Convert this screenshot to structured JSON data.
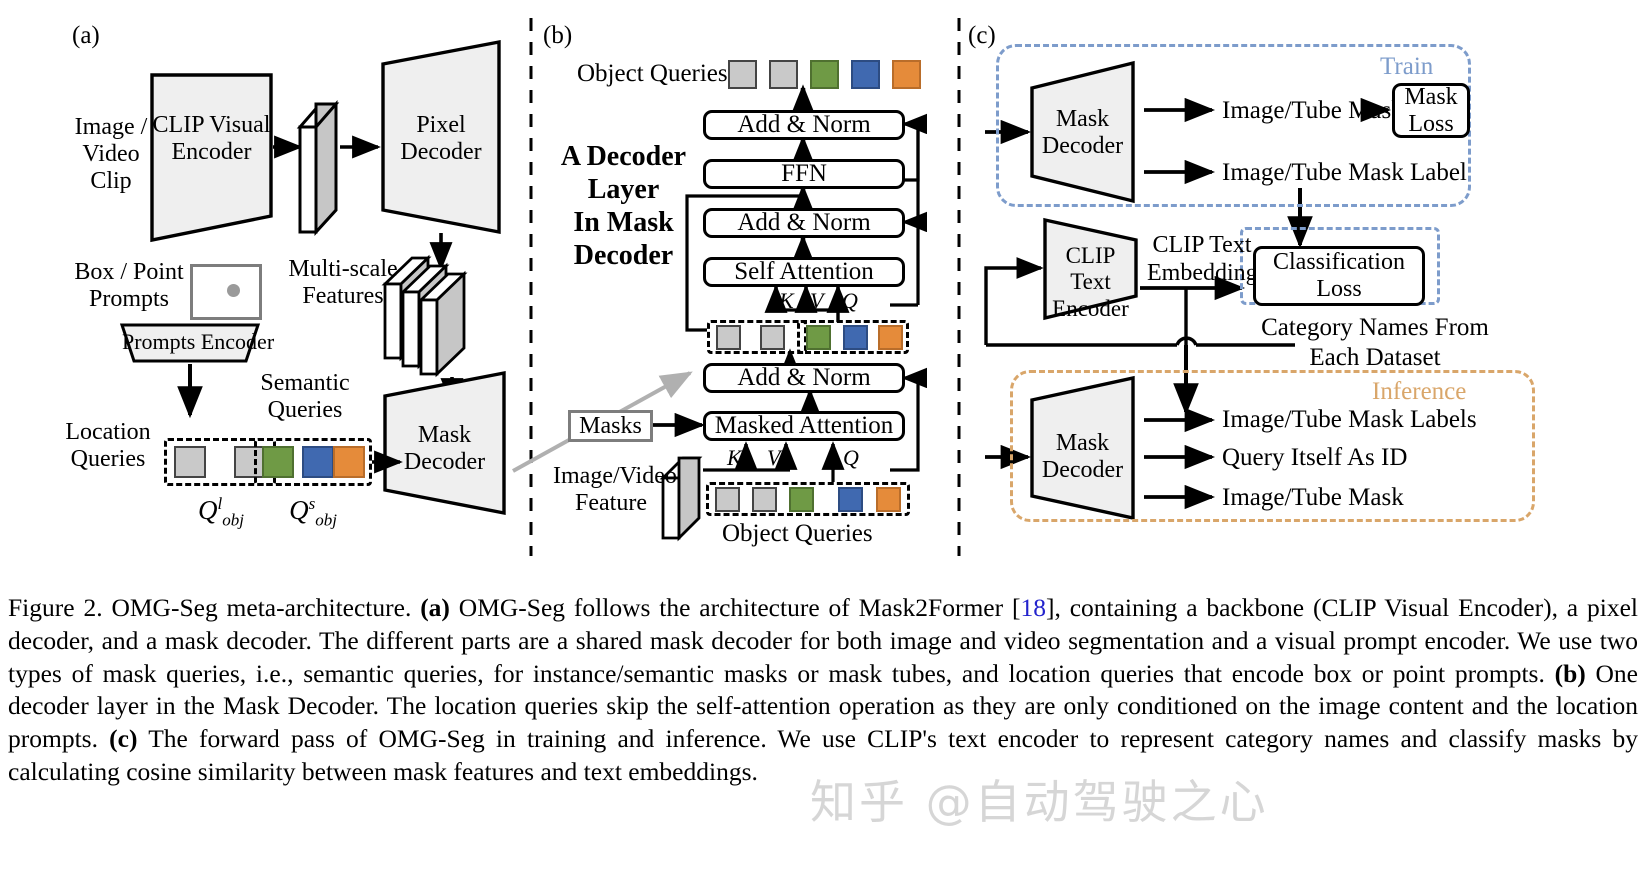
{
  "figure": {
    "panels": {
      "a": "(a)",
      "b": "(b)",
      "c": "(c)"
    }
  },
  "panel_a": {
    "input_label": "Image /\nVideo Clip",
    "clip_visual_encoder": "CLIP Visual\nEncoder",
    "pixel_decoder": "Pixel\nDecoder",
    "multiscale_features": "Multi-scale\nFeatures",
    "box_point_prompts": "Box / Point\nPrompts",
    "prompts_encoder": "Prompts Encoder",
    "location_queries": "Location\nQueries",
    "semantic_queries": "Semantic\nQueries",
    "mask_decoder": "Mask\nDecoder",
    "q_location": "Q",
    "q_location_sup": "l",
    "q_location_sub": "obj",
    "q_semantic": "Q",
    "q_semantic_sup": "s",
    "q_semantic_sub": "obj"
  },
  "panel_b": {
    "title": "A Decoder\nLayer\nIn Mask\nDecoder",
    "object_queries_top": "Object Queries",
    "object_queries_bottom": "Object Queries",
    "add_norm_1": "Add & Norm",
    "ffn": "FFN",
    "add_norm_2": "Add & Norm",
    "self_attention": "Self Attention",
    "add_norm_3": "Add & Norm",
    "masked_attention": "Masked Attention",
    "masks": "Masks",
    "image_video_feature": "Image/Video\nFeature",
    "k": "K",
    "v": "V",
    "q": "Q"
  },
  "panel_c": {
    "train_label": "Train",
    "inference_label": "Inference",
    "mask_decoder_train": "Mask\nDecoder",
    "mask_decoder_infer": "Mask\nDecoder",
    "clip_text_encoder": "CLIP Text\nEncoder",
    "clip_text_embedding": "CLIP Text\nEmbedding",
    "image_tube_mask": "Image/Tube Mask",
    "mask_loss": "Mask\nLoss",
    "image_tube_mask_label": "Image/Tube Mask Label",
    "classification_loss": "Classification\nLoss",
    "category_names": "Category Names From\nEach Dataset",
    "image_tube_mask_labels": "Image/Tube Mask Labels",
    "query_itself_as_id": "Query Itself As ID",
    "image_tube_mask_out": "Image/Tube Mask"
  },
  "caption": {
    "full": "Figure 2. OMG-Seg meta-architecture. (a) OMG-Seg follows the architecture of Mask2Former [18], containing a backbone (CLIP Visual Encoder), a pixel decoder, and a mask decoder. The different parts are a shared mask decoder for both image and video segmentation and a visual prompt encoder. We use two types of mask queries, i.e., semantic queries, for instance/semantic masks or mask tubes, and location queries that encode box or point prompts. (b) One decoder layer in the Mask Decoder. The location queries skip the self-attention operation as they are only conditioned on the image content and the location prompts. (c) The forward pass of OMG-Seg in training and inference. We use CLIP's text encoder to represent category names and classify masks by calculating cosine similarity between mask features and text embeddings.",
    "segments": {
      "s1": "Figure 2. OMG-Seg meta-architecture. ",
      "tag_a": "(a)",
      "s2": " OMG-Seg follows the architecture of Mask2Former [",
      "ref": "18",
      "s3": "], containing a backbone (CLIP Visual Encoder), a pixel decoder, and a mask decoder. The different parts are a shared mask decoder for both image and video segmentation and a visual prompt encoder. We use two types of mask queries, i.e., semantic queries, for instance/semantic masks or mask tubes, and location queries that encode box or point prompts. ",
      "tag_b": "(b)",
      "s4": " One decoder layer in the Mask Decoder. The location queries skip the self-attention operation as they are only conditioned on the image content and the location prompts. ",
      "tag_c": "(c)",
      "s5": " The forward pass of OMG-Seg in training and inference. We use CLIP's text encoder to represent category names and classify masks by calculating cosine similarity between mask features and text embeddings."
    }
  },
  "watermark": "知乎 @自动驾驶之心",
  "colors": {
    "query_gray": "#c9c9c9",
    "query_green": "#6f9a45",
    "query_blue": "#4069b0",
    "query_orange": "#e58b3a",
    "trapezoid_fill": "#efefef",
    "feature_fill": "#c6c6c6",
    "train_dashed": "#7d9ccb",
    "inference_dashed": "#d9a66a",
    "ref_link": "#2222cc"
  }
}
